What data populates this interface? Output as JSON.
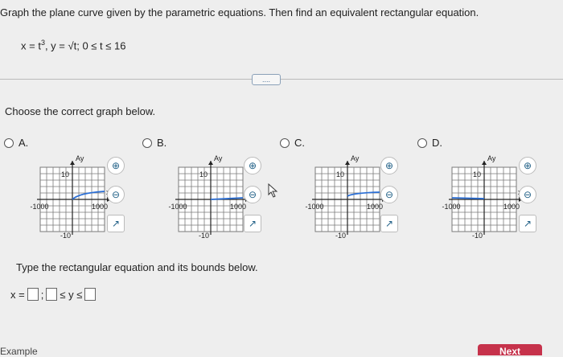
{
  "question": "Graph the plane curve given by the parametric equations. Then find an equivalent rectangular equation.",
  "equation": {
    "x_part": "x = t",
    "exponent": "3",
    "y_part": ", y = √t; 0 ≤ t ≤ 16"
  },
  "more_button": "....",
  "prompt": "Choose the correct graph below.",
  "options": [
    {
      "letter": "A.",
      "curve": "cube-root-through-origin"
    },
    {
      "letter": "B.",
      "curve": "flat-positive"
    },
    {
      "letter": "C.",
      "curve": "rising-positive"
    },
    {
      "letter": "D.",
      "curve": "flat-negative-left"
    }
  ],
  "graph_labels": {
    "y_axis": "Ay",
    "x_axis": "x",
    "y_max": "10",
    "y_min": "-10",
    "x_min": "-1000",
    "x_max": "1000"
  },
  "tool_icons": [
    "zoom-in-icon",
    "zoom-out-icon",
    "popout-icon"
  ],
  "type_prompt": "Type the rectangular equation and its bounds below.",
  "answer": {
    "lhs": "x =",
    "sep": ";",
    "mid": "≤ y ≤"
  },
  "next_label": "Next",
  "example_label": "Example",
  "colors": {
    "curve": "#2b6fd6",
    "grid": "#7a7a7a",
    "next": "#c6324b"
  }
}
